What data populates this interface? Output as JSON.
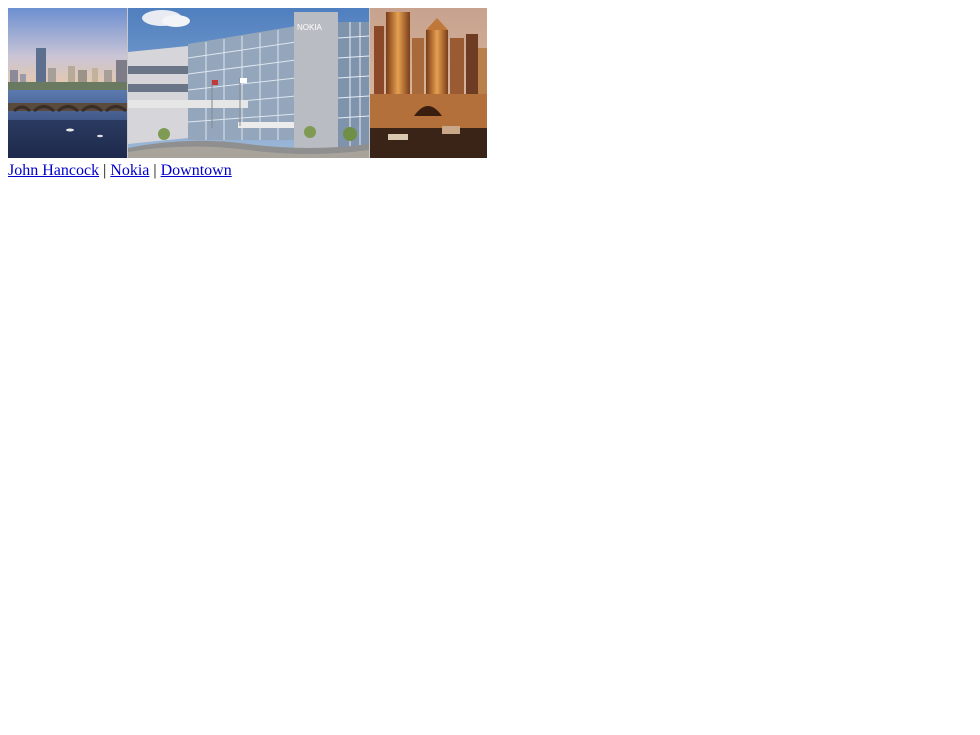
{
  "photos": [
    {
      "icon": "john-hancock-skyline-photo"
    },
    {
      "icon": "nokia-building-photo",
      "sign_text": "NOKIA"
    },
    {
      "icon": "downtown-skyline-photo"
    }
  ],
  "links": {
    "john_hancock": "John Hancock",
    "nokia": "Nokia",
    "downtown": "Downtown",
    "separator": " | "
  },
  "colors": {
    "link": "#0000cc",
    "background": "#ffffff"
  }
}
